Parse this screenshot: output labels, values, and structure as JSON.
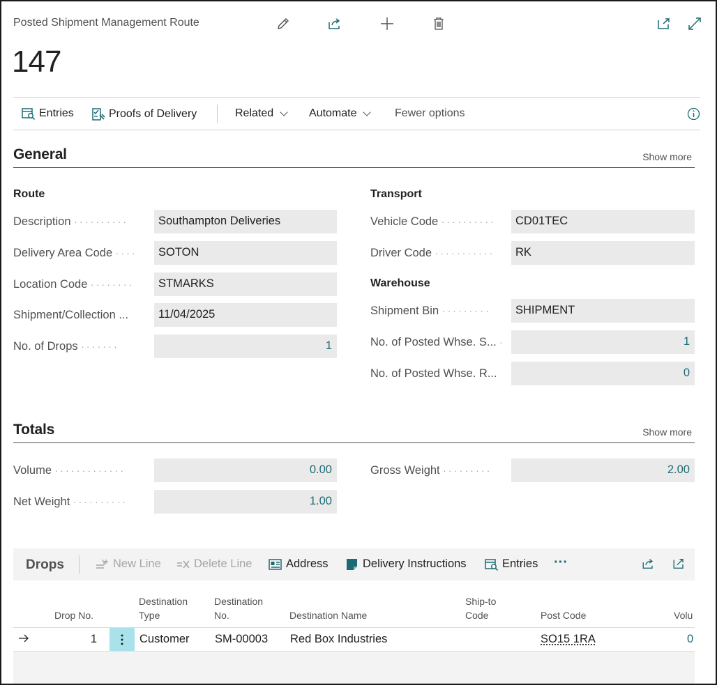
{
  "header": {
    "page_type": "Posted Shipment Management Route",
    "record_no": "147",
    "icons": [
      "edit-icon",
      "share-icon",
      "new-icon",
      "delete-icon",
      "open-new-window-icon",
      "expand-icon"
    ]
  },
  "actions": {
    "entries": "Entries",
    "proofs_of_delivery": "Proofs of Delivery",
    "related": "Related",
    "automate": "Automate",
    "fewer_options": "Fewer options"
  },
  "general": {
    "title": "General",
    "show_more": "Show more",
    "route": {
      "title": "Route",
      "description_label": "Description",
      "description": "Southampton Deliveries",
      "delivery_area_label": "Delivery Area Code",
      "delivery_area": "SOTON",
      "location_label": "Location Code",
      "location": "STMARKS",
      "shipment_date_label": "Shipment/Collection ...",
      "shipment_date": "11/04/2025",
      "drops_label": "No. of Drops",
      "drops": "1"
    },
    "transport": {
      "title": "Transport",
      "vehicle_label": "Vehicle Code",
      "vehicle": "CD01TEC",
      "driver_label": "Driver Code",
      "driver": "RK"
    },
    "warehouse": {
      "title": "Warehouse",
      "bin_label": "Shipment Bin",
      "bin": "SHIPMENT",
      "posted_s_label": "No. of Posted Whse. S...",
      "posted_s": "1",
      "posted_r_label": "No. of Posted Whse. R...",
      "posted_r": "0"
    }
  },
  "totals": {
    "title": "Totals",
    "show_more": "Show more",
    "volume_label": "Volume",
    "volume": "0.00",
    "net_weight_label": "Net Weight",
    "net_weight": "1.00",
    "gross_weight_label": "Gross Weight",
    "gross_weight": "2.00"
  },
  "drops": {
    "title": "Drops",
    "new_line": "New Line",
    "delete_line": "Delete Line",
    "address": "Address",
    "delivery_instructions": "Delivery Instructions",
    "entries": "Entries",
    "more": "···",
    "columns": {
      "drop_no": "Drop No.",
      "dest_type_1": "Destination",
      "dest_type_2": "Type",
      "dest_no_1": "Destination",
      "dest_no_2": "No.",
      "dest_name": "Destination Name",
      "ship_to_1": "Ship-to",
      "ship_to_2": "Code",
      "post_code": "Post Code",
      "volume": "Volu"
    },
    "rows": [
      {
        "drop_no": "1",
        "dest_type": "Customer",
        "dest_no": "SM-00003",
        "dest_name": "Red Box Industries",
        "ship_to": "",
        "post_code": "SO15 1RA",
        "volume": "0"
      }
    ]
  },
  "colors": {
    "accent": "#1c6b74",
    "field_bg": "#eaeaea",
    "selected_cell": "#a9e2ea"
  }
}
